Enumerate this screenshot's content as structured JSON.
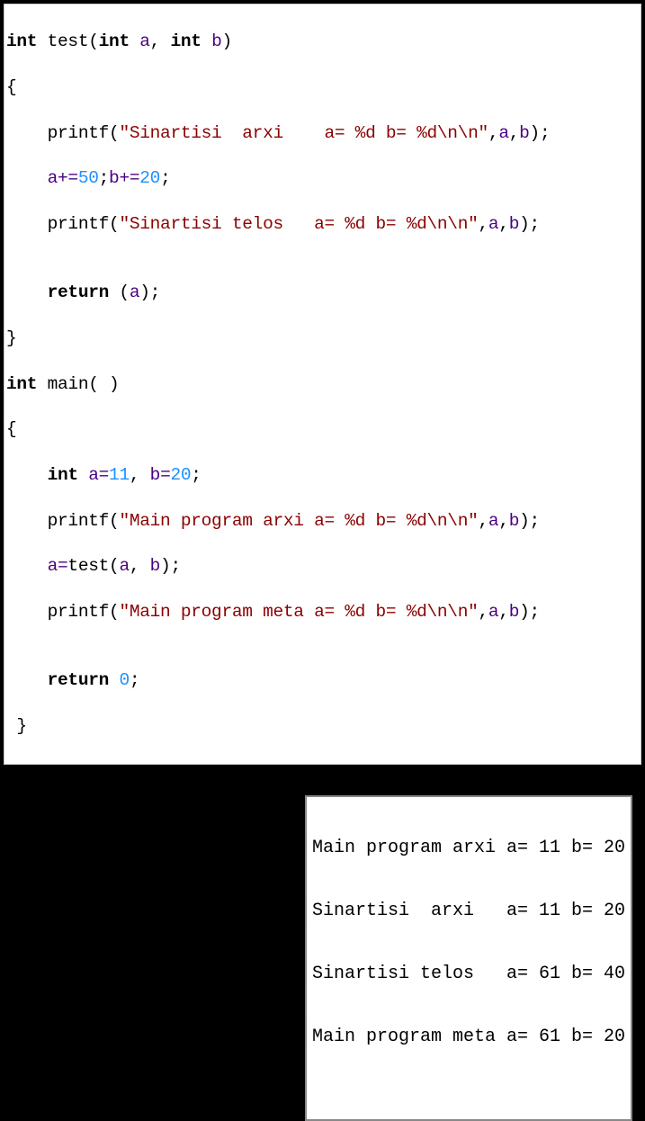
{
  "code": {
    "l1": {
      "kw1": "int",
      "fn": " test",
      "pn1": "(",
      "kw2": "int",
      "id1": " a",
      "c1": ", ",
      "kw3": "int",
      "id2": " b",
      "pn2": ")"
    },
    "l2": {
      "br": "{"
    },
    "l3": {
      "pad": "    ",
      "fn": "printf",
      "pn1": "(",
      "str": "\"Sinartisi  arxi    a= %d b= %d\\n\\n\"",
      "c1": ",",
      "id1": "a",
      "c2": ",",
      "id2": "b",
      "pn2": ")",
      "sc": ";"
    },
    "l4": {
      "pad": "    ",
      "id1": "a",
      "op1": "+=",
      "n1": "50",
      "sc1": ";",
      "id2": "b",
      "op2": "+=",
      "n2": "20",
      "sc2": ";"
    },
    "l5": {
      "pad": "    ",
      "fn": "printf",
      "pn1": "(",
      "str": "\"Sinartisi telos   a= %d b= %d\\n\\n\"",
      "c1": ",",
      "id1": "a",
      "c2": ",",
      "id2": "b",
      "pn2": ")",
      "sc": ";"
    },
    "l6": {
      "pad": ""
    },
    "l7": {
      "pad": "    ",
      "kw": "return",
      "pn1": " (",
      "id": "a",
      "pn2": ")",
      "sc": ";"
    },
    "l8": {
      "br": "}"
    },
    "l9": {
      "kw": "int",
      "fn": " main",
      "pn": "( )"
    },
    "l10": {
      "br": "{"
    },
    "l11": {
      "pad": "    ",
      "kw": "int",
      "id1": " a",
      "op1": "=",
      "n1": "11",
      "c1": ", ",
      "id2": "b",
      "op2": "=",
      "n2": "20",
      "sc": ";"
    },
    "l12": {
      "pad": "    ",
      "fn": "printf",
      "pn1": "(",
      "str": "\"Main program arxi a= %d b= %d\\n\\n\"",
      "c1": ",",
      "id1": "a",
      "c2": ",",
      "id2": "b",
      "pn2": ")",
      "sc": ";"
    },
    "l13": {
      "pad": "    ",
      "id1": "a",
      "op": "=",
      "fn": "test",
      "pn1": "(",
      "id2": "a",
      "c1": ", ",
      "id3": "b",
      "pn2": ")",
      "sc": ";"
    },
    "l14": {
      "pad": "    ",
      "fn": "printf",
      "pn1": "(",
      "str": "\"Main program meta a= %d b= %d\\n\\n\"",
      "c1": ",",
      "id1": "a",
      "c2": ",",
      "id2": "b",
      "pn2": ")",
      "sc": ";"
    },
    "l15": {
      "pad": ""
    },
    "l16": {
      "pad": "    ",
      "kw": "return",
      "sp": " ",
      "n": "0",
      "sc": ";"
    },
    "l17": {
      "pad": " ",
      "br": "}"
    }
  },
  "output": {
    "l1": "Main program arxi a= 11 b= 20",
    "l2": "Sinartisi  arxi   a= 11 b= 20",
    "l3": "Sinartisi telos   a= 61 b= 40",
    "l4": "Main program meta a= 61 b= 20"
  }
}
